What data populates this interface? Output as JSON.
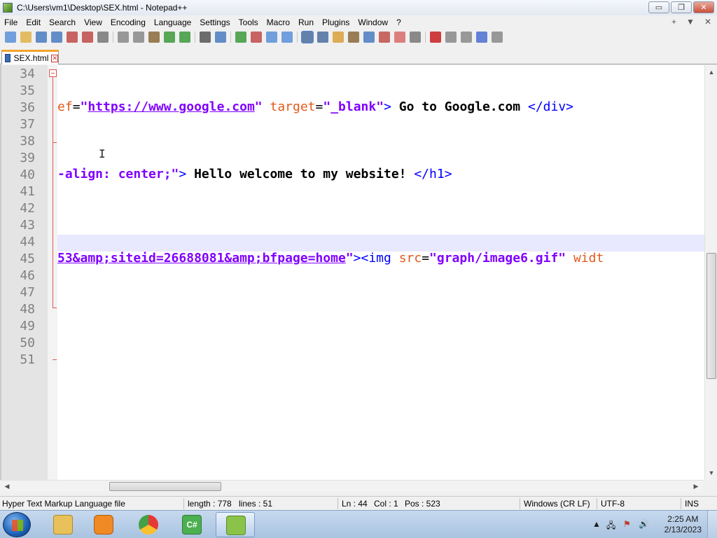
{
  "window": {
    "title": "C:\\Users\\vm1\\Desktop\\SEX.html - Notepad++",
    "minimize": "▭",
    "restore": "❐",
    "close": "✕"
  },
  "menu": {
    "items": [
      "File",
      "Edit",
      "Search",
      "View",
      "Encoding",
      "Language",
      "Settings",
      "Tools",
      "Macro",
      "Run",
      "Plugins",
      "Window",
      "?"
    ],
    "right": [
      "+",
      "▼",
      "✕"
    ]
  },
  "toolbar": {
    "icons": [
      "new-file-icon",
      "open-file-icon",
      "save-icon",
      "save-all-icon",
      "close-icon",
      "close-all-icon",
      "print-icon",
      "cut-icon",
      "copy-icon",
      "paste-icon",
      "undo-icon",
      "redo-icon",
      "find-icon",
      "replace-icon",
      "zoom-in-icon",
      "zoom-out-icon",
      "sync-vertical-icon",
      "sync-horizontal-icon",
      "word-wrap-icon",
      "show-all-chars-icon",
      "indent-guide-icon",
      "user-lang-icon",
      "doc-map-icon",
      "function-list-icon",
      "folder-as-workspace-icon",
      "monitoring-icon",
      "record-macro-icon",
      "stop-macro-icon",
      "play-macro-icon",
      "run-macro-multiple-icon",
      "save-macro-icon"
    ]
  },
  "tab": {
    "label": "SEX.html"
  },
  "editor": {
    "lines": [
      {
        "num": "34",
        "html": ""
      },
      {
        "num": "35",
        "html": ""
      },
      {
        "num": "36",
        "html": "<span class=\"c-attr\">ef</span><span class=\"c-eq\">=</span><span class=\"c-str\">\"</span><span class=\"c-url\">https://www.google.com</span><span class=\"c-str\">\"</span> <span class=\"c-attr\">target</span><span class=\"c-eq\">=</span><span class=\"c-str\">\"_blank\"</span><span class=\"c-tag\">&gt;</span><span class=\"c-text\"> Go to Google.com </span><span class=\"c-tag\">&lt;/div&gt;</span>"
      },
      {
        "num": "37",
        "html": ""
      },
      {
        "num": "38",
        "html": ""
      },
      {
        "num": "39",
        "html": ""
      },
      {
        "num": "40",
        "html": "<span class=\"c-str\">-align: center;\"</span><span class=\"c-tag\">&gt;</span><span class=\"c-text\"> Hello welcome to my website! </span><span class=\"c-tag\">&lt;/h1&gt;</span>"
      },
      {
        "num": "41",
        "html": ""
      },
      {
        "num": "42",
        "html": ""
      },
      {
        "num": "43",
        "html": ""
      },
      {
        "num": "44",
        "html": ""
      },
      {
        "num": "45",
        "html": "<span class=\"c-url\">53&amp;amp;siteid=26688081&amp;amp;bfpage=home</span><span class=\"c-str\">\"</span><span class=\"c-tag\">&gt;&lt;img</span> <span class=\"c-attr\">src</span><span class=\"c-eq\">=</span><span class=\"c-str\">\"graph/image6.gif\"</span> <span class=\"c-attr\">widt</span>"
      },
      {
        "num": "46",
        "html": ""
      },
      {
        "num": "47",
        "html": ""
      },
      {
        "num": "48",
        "html": ""
      },
      {
        "num": "49",
        "html": ""
      },
      {
        "num": "50",
        "html": ""
      },
      {
        "num": "51",
        "html": ""
      }
    ],
    "cursor_icon": "I"
  },
  "statusbar": {
    "file_type": "Hyper Text Markup Language file",
    "length": "length : 778",
    "lines": "lines : 51",
    "ln": "Ln : 44",
    "col": "Col : 1",
    "pos": "Pos : 523",
    "eol": "Windows (CR LF)",
    "encoding": "UTF-8",
    "mode": "INS"
  },
  "taskbar": {
    "apps": [
      {
        "name": "explorer",
        "color": "#e8c15a"
      },
      {
        "name": "media-player",
        "color": "#f08a24"
      },
      {
        "name": "chrome",
        "color": "#2e9d4f"
      },
      {
        "name": "csharp-app",
        "color": "#4caf50"
      },
      {
        "name": "notepadplusplus",
        "color": "#8bc34a"
      }
    ],
    "tray": {
      "up_arrow": "▲",
      "time": "2:25 AM",
      "date": "2/13/2023"
    }
  }
}
